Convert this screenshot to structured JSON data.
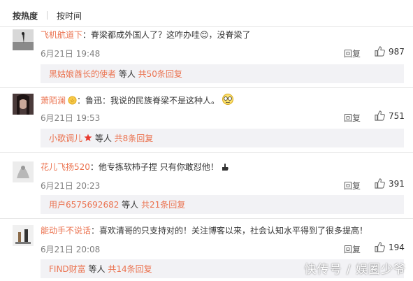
{
  "tabs": [
    {
      "label": "按热度"
    },
    {
      "label": "按时间"
    }
  ],
  "comments": [
    {
      "username": "飞机航道下",
      "text": "脊梁都成外国人了？这咋办哇😊，没脊梁了",
      "time": "6月21日 19:48",
      "reply_label": "回复",
      "likes": "987",
      "sub": {
        "user": "黑姑娘酋长的使者",
        "mid": " 等人 ",
        "count": "共50条回复"
      }
    },
    {
      "username": "萧陌澜",
      "text": "鲁迅：我说的民族脊梁不是这种人。",
      "time": "6月21日 19:53",
      "reply_label": "回复",
      "likes": "751",
      "sub": {
        "user": "小歌调儿",
        "mid": " 等人 ",
        "count": "共8条回复"
      }
    },
    {
      "username": "花儿飞扬520",
      "text": "他专拣软柿子捏 只有你敢怼他！",
      "time": "6月21日 20:23",
      "reply_label": "回复",
      "likes": "391",
      "sub": {
        "user": "用户6575692682",
        "mid": " 等人 ",
        "count": "共21条回复"
      }
    },
    {
      "username": "能动手不说话",
      "text": "喜欢清哥的只支持对的！关注博客以来，社会认知水平得到了很多提高！",
      "time": "6月21日 20:08",
      "reply_label": "回复",
      "likes": "194",
      "sub": {
        "user": "FIND财富",
        "mid": " 等人 ",
        "count": "共14条回复"
      }
    }
  ],
  "watermark": "快传号 / 娱圈少爷",
  "colors": {
    "link": "#eb7350",
    "subbg": "#f2f2f5",
    "divider": "#e6e6e6"
  }
}
